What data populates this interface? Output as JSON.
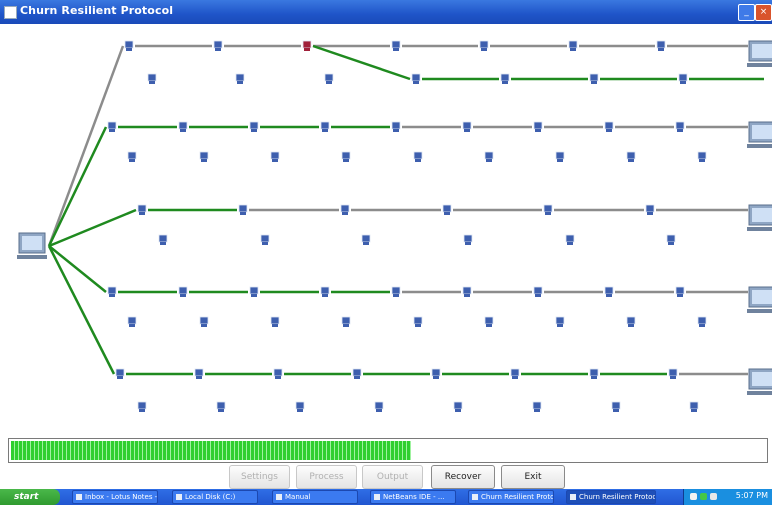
{
  "window": {
    "title": "Churn Resilient Protocol",
    "minimize_label": "_",
    "close_label": "×"
  },
  "buttons": [
    {
      "label": "Settings",
      "enabled": false
    },
    {
      "label": "Process",
      "enabled": false
    },
    {
      "label": "Output",
      "enabled": false
    },
    {
      "label": "Recover",
      "enabled": true
    },
    {
      "label": "Exit",
      "enabled": true
    }
  ],
  "progress": {
    "percent": 53
  },
  "taskbar": {
    "start_label": "start",
    "tasks": [
      {
        "label": "Inbox - Lotus Notes - ...",
        "active": false
      },
      {
        "label": "Local Disk (C:)",
        "active": false
      },
      {
        "label": "Manual",
        "active": false
      },
      {
        "label": "NetBeans IDE - ...",
        "active": false
      },
      {
        "label": "Churn Resilient Proto...",
        "active": false
      },
      {
        "label": "Churn Resilient Protocol",
        "active": true
      }
    ],
    "clock": "5:07 PM"
  },
  "colors": {
    "active_link": "#1f8a1f",
    "idle_link": "#8c8c8c",
    "node": "#3e5fae",
    "failed_node": "#a0203a",
    "progress": "#2fcf2f"
  },
  "network": {
    "source_icon": "computer-icon",
    "node_icon": "network-node-icon",
    "destination_icon": "computer-icon",
    "failed_node_icon": "failed-node-icon"
  }
}
